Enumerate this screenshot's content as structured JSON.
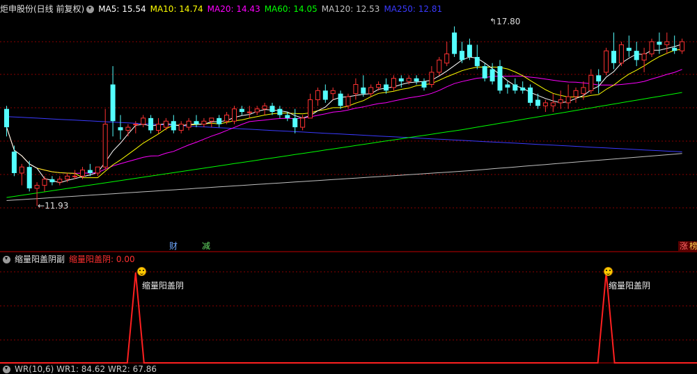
{
  "main_panel": {
    "title": "炬申股份(日线 前复权)",
    "ma": [
      {
        "label": "MA5: 15.54",
        "color": "#ffffff"
      },
      {
        "label": "MA10: 14.74",
        "color": "#ffff00"
      },
      {
        "label": "MA20: 14.43",
        "color": "#ff00ff"
      },
      {
        "label": "MA60: 14.05",
        "color": "#00ff00"
      },
      {
        "label": "MA120: 12.53",
        "color": "#c0c0c0"
      },
      {
        "label": "MA250: 12.81",
        "color": "#3a3aff"
      }
    ],
    "high_label": "17.80",
    "low_label": "11.93",
    "tags": [
      {
        "text": "财",
        "color": "#6fa8ff"
      },
      {
        "text": "减",
        "color": "#66dd66"
      },
      {
        "text": "涨",
        "color": "#ff6666"
      },
      {
        "text": "榜",
        "color": "#ffd34d"
      }
    ]
  },
  "sub_panel": {
    "title": "缩量阳盖阴副",
    "value_label": "缩量阳盖阴: 0.00",
    "signal_label": "缩量阳盖阴"
  },
  "bottom_panel": {
    "label_partial": "WR(10,6)  WR1: 84.62  WR2: 67.86"
  },
  "colors": {
    "up": "#ff3232",
    "down": "#54ffff",
    "signal": "#ff2020",
    "grid": "#8b0000"
  },
  "chart_data": {
    "type": "candlestick",
    "ohlc": [
      [
        15.1,
        15.2,
        14.2,
        14.5
      ],
      [
        13.7,
        13.9,
        12.9,
        13.0
      ],
      [
        13.0,
        13.3,
        12.6,
        13.2
      ],
      [
        13.2,
        13.4,
        12.4,
        12.5
      ],
      [
        12.5,
        12.7,
        11.93,
        12.6
      ],
      [
        12.6,
        12.9,
        12.4,
        12.8
      ],
      [
        12.8,
        12.9,
        12.6,
        12.7
      ],
      [
        12.7,
        12.9,
        12.6,
        12.8
      ],
      [
        12.8,
        13.0,
        12.7,
        12.9
      ],
      [
        12.9,
        13.1,
        12.8,
        12.9
      ],
      [
        12.9,
        13.2,
        12.8,
        13.1
      ],
      [
        13.1,
        13.3,
        12.9,
        13.0
      ],
      [
        13.0,
        13.2,
        12.9,
        13.2
      ],
      [
        13.2,
        15.1,
        13.1,
        14.6
      ],
      [
        15.9,
        16.5,
        14.2,
        14.7
      ],
      [
        14.5,
        14.9,
        14.1,
        14.4
      ],
      [
        14.4,
        14.6,
        14.2,
        14.5
      ],
      [
        14.6,
        14.7,
        14.3,
        14.6
      ],
      [
        14.6,
        14.9,
        14.5,
        14.8
      ],
      [
        14.8,
        14.9,
        14.3,
        14.4
      ],
      [
        14.4,
        14.8,
        14.3,
        14.6
      ],
      [
        14.5,
        14.8,
        14.4,
        14.7
      ],
      [
        14.7,
        14.9,
        14.3,
        14.4
      ],
      [
        14.4,
        14.7,
        14.3,
        14.6
      ],
      [
        14.5,
        14.8,
        14.4,
        14.7
      ],
      [
        14.7,
        14.9,
        14.5,
        14.6
      ],
      [
        14.6,
        14.8,
        14.5,
        14.7
      ],
      [
        14.7,
        14.8,
        14.5,
        14.8
      ],
      [
        14.8,
        14.9,
        14.5,
        14.6
      ],
      [
        14.7,
        15.0,
        14.6,
        14.9
      ],
      [
        14.7,
        15.2,
        14.6,
        15.1
      ],
      [
        15.1,
        15.2,
        14.9,
        15.0
      ],
      [
        15.0,
        15.2,
        14.8,
        15.0
      ],
      [
        15.0,
        15.2,
        14.9,
        15.1
      ],
      [
        15.1,
        15.3,
        14.9,
        15.2
      ],
      [
        15.2,
        15.3,
        14.9,
        15.0
      ],
      [
        15.1,
        15.2,
        14.8,
        14.9
      ],
      [
        14.9,
        15.0,
        14.7,
        14.8
      ],
      [
        14.8,
        15.1,
        14.3,
        14.5
      ],
      [
        14.5,
        14.9,
        14.4,
        14.8
      ],
      [
        14.8,
        15.6,
        14.8,
        15.4
      ],
      [
        15.4,
        15.8,
        15.2,
        15.7
      ],
      [
        15.7,
        15.9,
        15.3,
        15.4
      ],
      [
        15.6,
        15.8,
        15.4,
        15.7
      ],
      [
        15.6,
        15.7,
        15.1,
        15.2
      ],
      [
        15.2,
        15.6,
        15.1,
        15.5
      ],
      [
        15.6,
        16.1,
        15.4,
        15.9
      ],
      [
        15.8,
        16.2,
        15.5,
        15.6
      ],
      [
        15.6,
        15.9,
        15.5,
        15.8
      ],
      [
        15.8,
        16.0,
        15.7,
        15.9
      ],
      [
        15.9,
        16.1,
        15.6,
        15.7
      ],
      [
        15.8,
        16.2,
        15.7,
        16.1
      ],
      [
        16.1,
        16.2,
        15.8,
        16.0
      ],
      [
        16.0,
        16.2,
        15.9,
        16.1
      ],
      [
        16.1,
        16.2,
        15.9,
        16.0
      ],
      [
        16.0,
        16.1,
        15.7,
        15.8
      ],
      [
        15.9,
        16.5,
        15.8,
        16.3
      ],
      [
        16.3,
        16.8,
        16.2,
        16.7
      ],
      [
        16.6,
        17.3,
        16.5,
        16.9
      ],
      [
        17.6,
        17.8,
        16.8,
        16.9
      ],
      [
        17.0,
        17.3,
        16.6,
        16.7
      ],
      [
        17.2,
        17.4,
        16.7,
        16.8
      ],
      [
        16.8,
        17.2,
        16.4,
        16.5
      ],
      [
        16.5,
        16.6,
        16.0,
        16.1
      ],
      [
        16.4,
        16.6,
        15.9,
        16.0
      ],
      [
        16.5,
        16.7,
        15.6,
        15.7
      ],
      [
        15.9,
        16.0,
        15.6,
        15.8
      ],
      [
        15.9,
        16.1,
        15.6,
        15.7
      ],
      [
        15.8,
        16.0,
        15.6,
        15.7
      ],
      [
        15.8,
        15.9,
        15.2,
        15.3
      ],
      [
        15.4,
        15.6,
        15.1,
        15.2
      ],
      [
        15.2,
        15.4,
        15.0,
        15.3
      ],
      [
        15.2,
        15.6,
        15.0,
        15.3
      ],
      [
        15.3,
        15.7,
        15.1,
        15.4
      ],
      [
        15.3,
        15.9,
        15.1,
        15.5
      ],
      [
        15.5,
        15.8,
        15.3,
        15.7
      ],
      [
        15.6,
        16.0,
        15.4,
        15.8
      ],
      [
        15.7,
        16.4,
        15.6,
        16.2
      ],
      [
        16.2,
        16.4,
        15.6,
        16.0
      ],
      [
        16.3,
        17.1,
        16.2,
        17.0
      ],
      [
        17.0,
        17.6,
        16.4,
        16.6
      ],
      [
        16.6,
        17.3,
        16.5,
        17.2
      ],
      [
        17.1,
        17.5,
        16.8,
        17.0
      ],
      [
        17.0,
        17.3,
        16.5,
        16.7
      ],
      [
        16.7,
        17.1,
        16.3,
        16.9
      ],
      [
        16.9,
        17.4,
        16.8,
        17.3
      ],
      [
        17.3,
        17.6,
        16.9,
        17.2
      ],
      [
        17.2,
        17.6,
        16.9,
        17.3
      ],
      [
        17.1,
        17.5,
        16.9,
        17.0
      ],
      [
        17.0,
        17.4,
        16.9,
        17.3
      ]
    ],
    "signals": [
      17,
      79
    ]
  }
}
